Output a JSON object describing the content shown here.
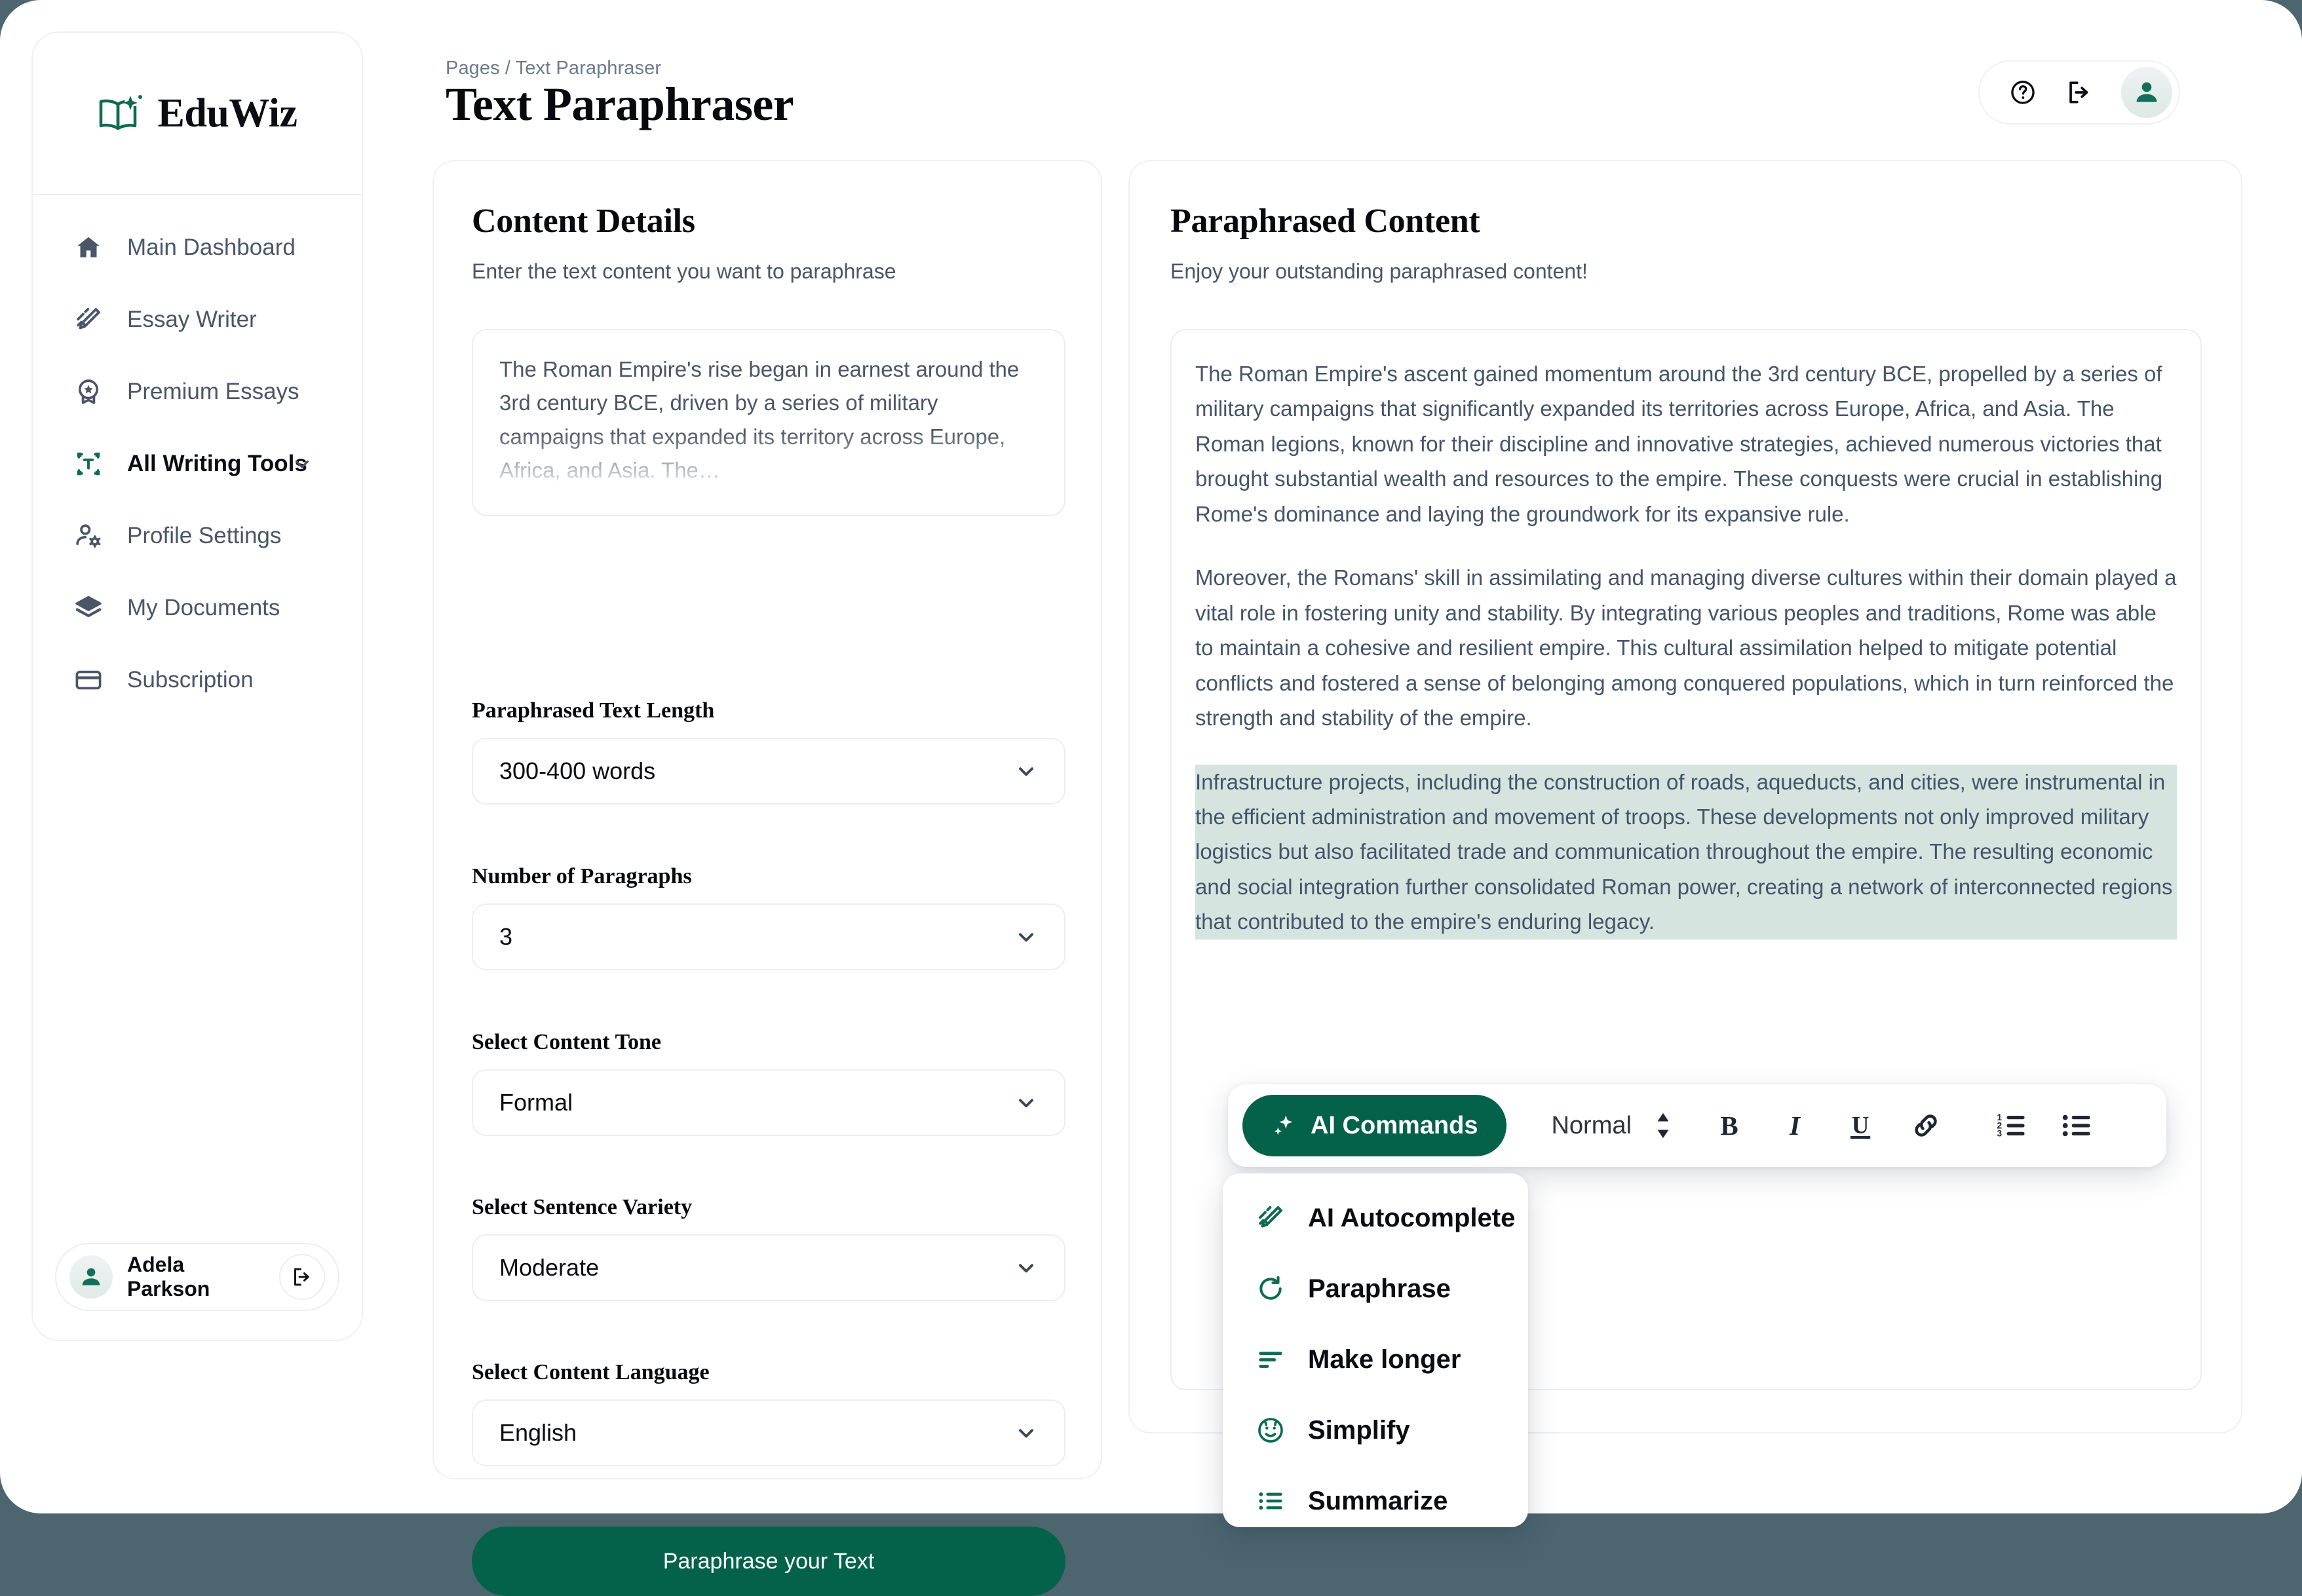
{
  "brand": {
    "name": "EduWiz",
    "logo_icon": "book-sparkle-icon"
  },
  "sidebar": {
    "items": [
      {
        "label": "Main Dashboard",
        "icon": "home-icon",
        "active": false
      },
      {
        "label": "Essay Writer",
        "icon": "magic-pencil-icon",
        "active": false
      },
      {
        "label": "Premium Essays",
        "icon": "award-star-icon",
        "active": false
      },
      {
        "label": "All Writing Tools",
        "icon": "text-frame-icon",
        "active": true,
        "has_chevron": true
      },
      {
        "label": "Profile Settings",
        "icon": "user-gear-icon",
        "active": false
      },
      {
        "label": "My Documents",
        "icon": "layers-icon",
        "active": false
      },
      {
        "label": "Subscription",
        "icon": "credit-card-icon",
        "active": false
      }
    ],
    "user": {
      "name": "Adela Parkson",
      "avatar_icon": "user-avatar-icon",
      "logout_icon": "logout-icon"
    }
  },
  "header": {
    "breadcrumb": "Pages / Text Paraphraser",
    "title": "Text Paraphraser",
    "actions": {
      "help_icon": "question-circle-icon",
      "logout_icon": "logout-icon",
      "avatar_icon": "user-avatar-icon"
    }
  },
  "content_details": {
    "title": "Content Details",
    "subtitle": "Enter the text content you want to paraphrase",
    "source_text": "The Roman Empire's rise began in earnest around the 3rd century BCE, driven by a series of military campaigns that expanded its territory across Europe, Africa, and Asia. The…",
    "fields": [
      {
        "label": "Paraphrased Text Length",
        "value": "300-400 words",
        "name": "text-length"
      },
      {
        "label": "Number of Paragraphs",
        "value": "3",
        "name": "paragraph-count"
      },
      {
        "label": "Select Content Tone",
        "value": "Formal",
        "name": "content-tone"
      },
      {
        "label": "Select Sentence Variety",
        "value": "Moderate",
        "name": "sentence-variety"
      },
      {
        "label": "Select Content Language",
        "value": "English",
        "name": "content-language"
      }
    ],
    "submit_label": "Paraphrase your Text"
  },
  "paraphrased": {
    "title": "Paraphrased Content",
    "subtitle": "Enjoy your outstanding paraphrased content!",
    "paragraphs": [
      "The Roman Empire's ascent gained momentum around the 3rd century BCE, propelled by a series of military campaigns that significantly expanded its territories across Europe, Africa, and Asia. The Roman legions, known for their discipline and innovative strategies, achieved numerous victories that brought substantial wealth and resources to the empire. These conquests were crucial in establishing Rome's dominance and laying the groundwork for its expansive rule.",
      "Moreover, the Romans' skill in assimilating and managing diverse cultures within their domain played a vital role in fostering unity and stability. By integrating various peoples and traditions, Rome was able to maintain a cohesive and resilient empire. This cultural assimilation helped to mitigate potential conflicts and fostered a sense of belonging among conquered populations, which in turn reinforced the strength and stability of the empire.",
      "Infrastructure projects, including the construction of roads, aqueducts, and cities, were instrumental in the efficient administration and movement of troops. These developments not only improved military logistics but also facilitated trade and communication throughout the empire. The resulting economic and social integration further consolidated Roman power, creating a network of interconnected regions that contributed to the empire's enduring legacy."
    ],
    "highlighted_index": 2
  },
  "editor_toolbar": {
    "ai_commands_label": "AI Commands",
    "ai_commands_icon": "sparkle-icon",
    "block_style": "Normal",
    "block_style_icon": "up-down-arrows-icon",
    "buttons": [
      {
        "name": "bold-button",
        "icon": "bold-icon",
        "glyph": "B"
      },
      {
        "name": "italic-button",
        "icon": "italic-icon",
        "glyph": "I"
      },
      {
        "name": "underline-button",
        "icon": "underline-icon",
        "glyph": "U"
      },
      {
        "name": "link-button",
        "icon": "link-icon"
      },
      {
        "name": "ordered-list-button",
        "icon": "ordered-list-icon"
      },
      {
        "name": "bullet-list-button",
        "icon": "bullet-list-icon"
      }
    ]
  },
  "ai_menu": {
    "items": [
      {
        "label": "AI Autocomplete",
        "icon": "magic-pencil-icon"
      },
      {
        "label": "Paraphrase",
        "icon": "refresh-icon"
      },
      {
        "label": "Make longer",
        "icon": "align-left-icon"
      },
      {
        "label": "Simplify",
        "icon": "baby-face-icon"
      },
      {
        "label": "Summarize",
        "icon": "list-icon"
      }
    ]
  },
  "colors": {
    "accent_green": "#04624b",
    "page_background": "#4c656f",
    "highlight": "#d6e4df",
    "text_muted": "#4a5568"
  }
}
